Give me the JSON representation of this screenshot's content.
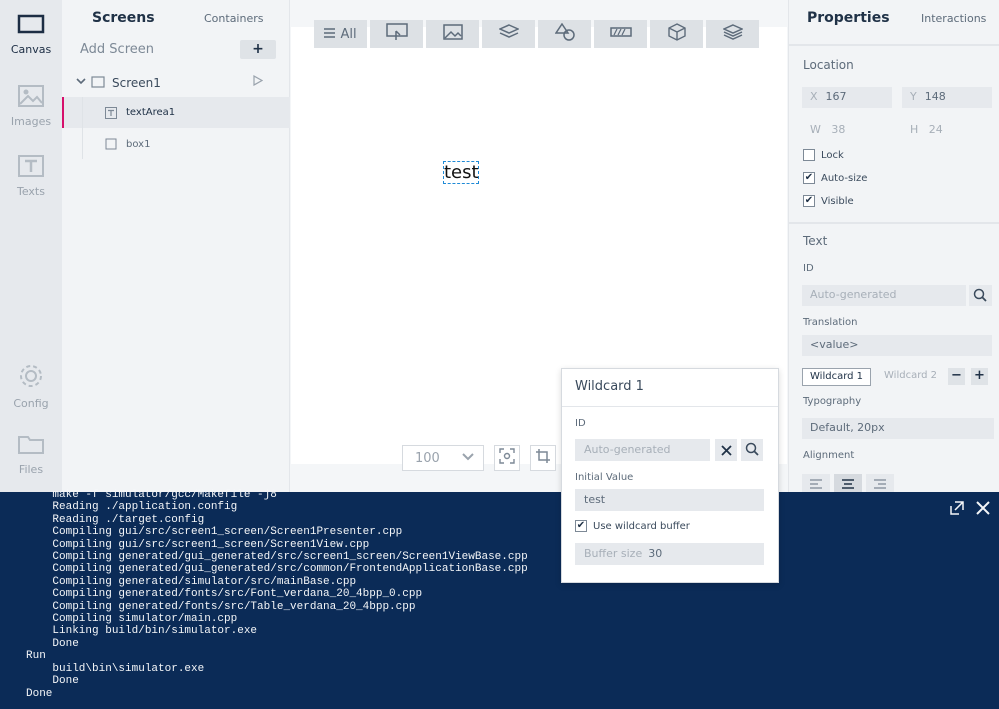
{
  "rail": {
    "items": [
      {
        "label": "Canvas",
        "icon": "canvas-icon"
      },
      {
        "label": "Images",
        "icon": "image-icon"
      },
      {
        "label": "Texts",
        "icon": "text-icon"
      },
      {
        "label": "Config",
        "icon": "gear-icon"
      },
      {
        "label": "Files",
        "icon": "folder-icon"
      }
    ]
  },
  "screens": {
    "tab_screens": "Screens",
    "tab_containers": "Containers",
    "add_screen": "Add Screen",
    "add_button": "+",
    "tree": [
      {
        "label": "Screen1"
      },
      {
        "label": "textArea1"
      },
      {
        "label": "box1"
      }
    ]
  },
  "canvas": {
    "filter_all": "All",
    "widget_text": "test",
    "zoom_value": "100"
  },
  "properties": {
    "title": "Properties",
    "tab_interactions": "Interactions",
    "location": {
      "heading": "Location",
      "x_label": "X",
      "x_value": "167",
      "y_label": "Y",
      "y_value": "148",
      "w_label": "W",
      "w_value": "38",
      "h_label": "H",
      "h_value": "24"
    },
    "checks": [
      {
        "label": "Lock",
        "checked": false
      },
      {
        "label": "Auto-size",
        "checked": true
      },
      {
        "label": "Visible",
        "checked": true
      }
    ],
    "text": {
      "heading": "Text",
      "id_label": "ID",
      "id_placeholder": "Auto-generated",
      "translation_label": "Translation",
      "translation_value": "<value>",
      "wildcard_tabs": [
        "Wildcard 1",
        "Wildcard 2"
      ],
      "minus": "−",
      "plus": "+",
      "typography_label": "Typography",
      "typography_value": "Default, 20px",
      "alignment_label": "Alignment"
    }
  },
  "console": {
    "lines": "    make -f simulator/gcc/Makefile -j8\n    Reading ./application.config\n    Reading ./target.config\n    Compiling gui/src/screen1_screen/Screen1Presenter.cpp\n    Compiling gui/src/screen1_screen/Screen1View.cpp\n    Compiling generated/gui_generated/src/screen1_screen/Screen1ViewBase.cpp\n    Compiling generated/gui_generated/src/common/FrontendApplicationBase.cpp\n    Compiling generated/simulator/src/mainBase.cpp\n    Compiling generated/fonts/src/Font_verdana_20_4bpp_0.cpp\n    Compiling generated/fonts/src/Table_verdana_20_4bpp.cpp\n    Compiling simulator/main.cpp\n    Linking build/bin/simulator.exe\n    Done\nRun\n    build\\bin\\simulator.exe\n    Done\nDone"
  },
  "wildcard_popup": {
    "title": "Wildcard 1",
    "id_label": "ID",
    "id_placeholder": "Auto-generated",
    "initial_value_label": "Initial Value",
    "initial_value": "test",
    "use_buffer_label": "Use wildcard buffer",
    "use_buffer_checked": true,
    "buffer_size_label": "Buffer size",
    "buffer_size_value": "30"
  },
  "colors": {
    "accent": "#d6106b",
    "console_bg": "#0b2b57",
    "selection": "#1f8ad6"
  }
}
